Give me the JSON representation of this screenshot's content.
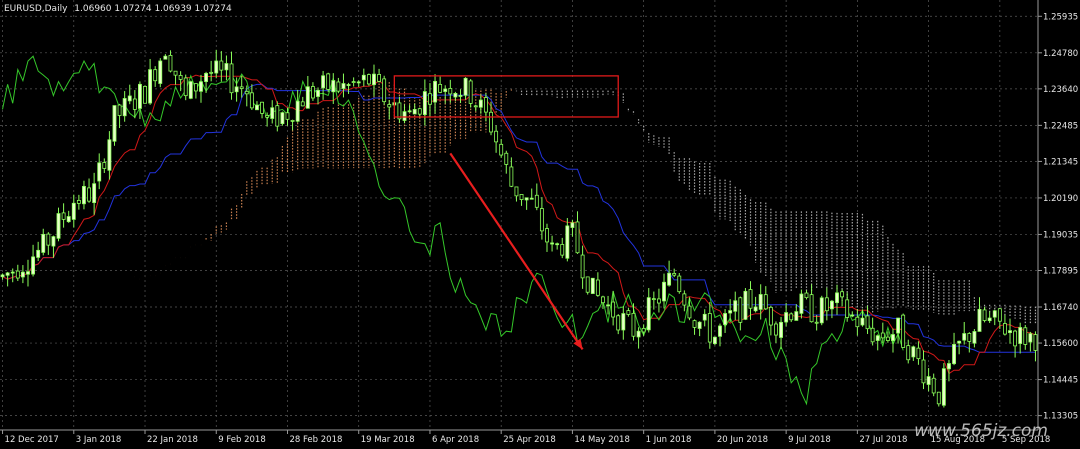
{
  "header": {
    "symbol": "EURUSD,Daily",
    "ohlc": "1.06960 1.07274 1.06939 1.07274"
  },
  "watermark": "www.565jz.com",
  "colors": {
    "background": "#000000",
    "grid": "#5a5a5a",
    "axis_text": "#e6e6e6",
    "bull_candle": "#e8ffc8",
    "bear_candle": "#000000",
    "wick": "#8bff5a",
    "chikou": "#35c82a",
    "tenkan": "#d01818",
    "kijun": "#2233dd",
    "cloud_bull": "#e0905a",
    "cloud_bear": "#b8b8b8",
    "box": "#e01a1a",
    "arrow": "#e81e1e"
  },
  "chart_data": {
    "type": "candlestick",
    "symbol": "EURUSD",
    "timeframe": "Daily",
    "indicator": "Ichimoku Kinko Hyo",
    "ylim": [
      1.1285,
      1.2645
    ],
    "ytick_labels": [
      "1.25935",
      "1.24780",
      "1.23640",
      "1.22485",
      "1.21345",
      "1.20190",
      "1.19035",
      "1.17895",
      "1.16740",
      "1.15600",
      "1.14445",
      "1.13305"
    ],
    "ytick_values": [
      1.25935,
      1.2478,
      1.2364,
      1.22485,
      1.21345,
      1.2019,
      1.19035,
      1.17895,
      1.1674,
      1.156,
      1.14445,
      1.13305
    ],
    "xtick_labels": [
      "12 Dec 2017",
      "3 Jan 2018",
      "22 Jan 2018",
      "9 Feb 2018",
      "28 Feb 2018",
      "19 Mar 2018",
      "6 Apr 2018",
      "25 Apr 2018",
      "14 May 2018",
      "1 Jun 2018",
      "20 Jun 2018",
      "9 Jul 2018",
      "27 Jul 2018",
      "15 Aug 2018",
      "5 Sep 2018"
    ],
    "xtick_index": [
      0,
      14,
      28,
      42,
      56,
      70,
      84,
      98,
      112,
      126,
      140,
      154,
      168,
      182,
      196
    ],
    "price_path": {
      "description_index_close_pairs": [
        [
          0,
          1.177
        ],
        [
          8,
          1.186
        ],
        [
          14,
          1.201
        ],
        [
          18,
          1.204
        ],
        [
          22,
          1.227
        ],
        [
          28,
          1.236
        ],
        [
          32,
          1.25
        ],
        [
          36,
          1.233
        ],
        [
          40,
          1.242
        ],
        [
          44,
          1.24
        ],
        [
          48,
          1.236
        ],
        [
          52,
          1.226
        ],
        [
          56,
          1.229
        ],
        [
          60,
          1.235
        ],
        [
          64,
          1.237
        ],
        [
          68,
          1.237
        ],
        [
          72,
          1.239
        ],
        [
          76,
          1.232
        ],
        [
          80,
          1.228
        ],
        [
          84,
          1.236
        ],
        [
          88,
          1.238
        ],
        [
          92,
          1.235
        ],
        [
          96,
          1.225
        ],
        [
          100,
          1.206
        ],
        [
          104,
          1.2
        ],
        [
          108,
          1.185
        ],
        [
          112,
          1.19
        ],
        [
          116,
          1.172
        ],
        [
          120,
          1.166
        ],
        [
          124,
          1.16
        ],
        [
          128,
          1.168
        ],
        [
          132,
          1.178
        ],
        [
          136,
          1.164
        ],
        [
          140,
          1.158
        ],
        [
          144,
          1.166
        ],
        [
          148,
          1.17
        ],
        [
          152,
          1.163
        ],
        [
          156,
          1.168
        ],
        [
          160,
          1.166
        ],
        [
          164,
          1.168
        ],
        [
          168,
          1.163
        ],
        [
          172,
          1.158
        ],
        [
          176,
          1.16
        ],
        [
          180,
          1.15
        ],
        [
          184,
          1.14
        ],
        [
          188,
          1.155
        ],
        [
          192,
          1.163
        ],
        [
          196,
          1.162
        ],
        [
          200,
          1.158
        ]
      ]
    },
    "annotations": [
      {
        "type": "rectangle",
        "color": "red",
        "from_index": 77,
        "to_index": 121,
        "price_top": 1.2405,
        "price_bottom": 1.2275
      },
      {
        "type": "arrow",
        "color": "red",
        "from_index": 88,
        "from_price": 1.216,
        "to_index": 114,
        "to_price": 1.154
      }
    ],
    "grid": true
  }
}
